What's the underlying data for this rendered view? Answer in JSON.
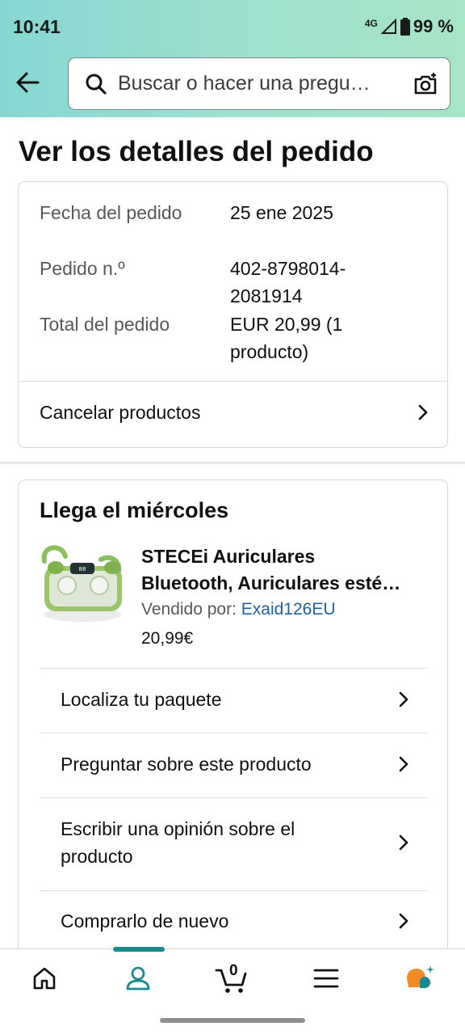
{
  "status_bar": {
    "time": "10:41",
    "network": "4G",
    "battery": "99 %"
  },
  "search": {
    "placeholder": "Buscar o hacer una pregu…"
  },
  "page_title": "Ver los detalles del pedido",
  "order_summary": {
    "date_label": "Fecha del pedido",
    "date_value": "25 ene 2025",
    "number_label": "Pedido n.º",
    "number_value": "402-8798014-2081914",
    "total_label": "Total del pedido",
    "total_value": "EUR 20,99 (1 producto)",
    "cancel_label": "Cancelar productos"
  },
  "shipment": {
    "arrival": "Llega el miércoles",
    "product_title_line1": "STECEi Auriculares",
    "product_title_line2": "Bluetooth, Auriculares esté…",
    "seller_prefix": "Vendido por: ",
    "seller_name": "Exaid126EU",
    "price": "20,99€",
    "actions": [
      {
        "label": "Localiza tu paquete"
      },
      {
        "label": "Preguntar sobre este producto"
      },
      {
        "label": "Escribir una opinión sobre el producto"
      },
      {
        "label": "Comprarlo de nuevo"
      }
    ]
  },
  "bottom_nav": {
    "cart_count": "0",
    "active": "account"
  },
  "colors": {
    "header_gradient_start": "#86d7d3",
    "header_gradient_end": "#a8e4c6",
    "link": "#2162a1",
    "accent": "#1b8a8f",
    "orange": "#f08b28"
  }
}
